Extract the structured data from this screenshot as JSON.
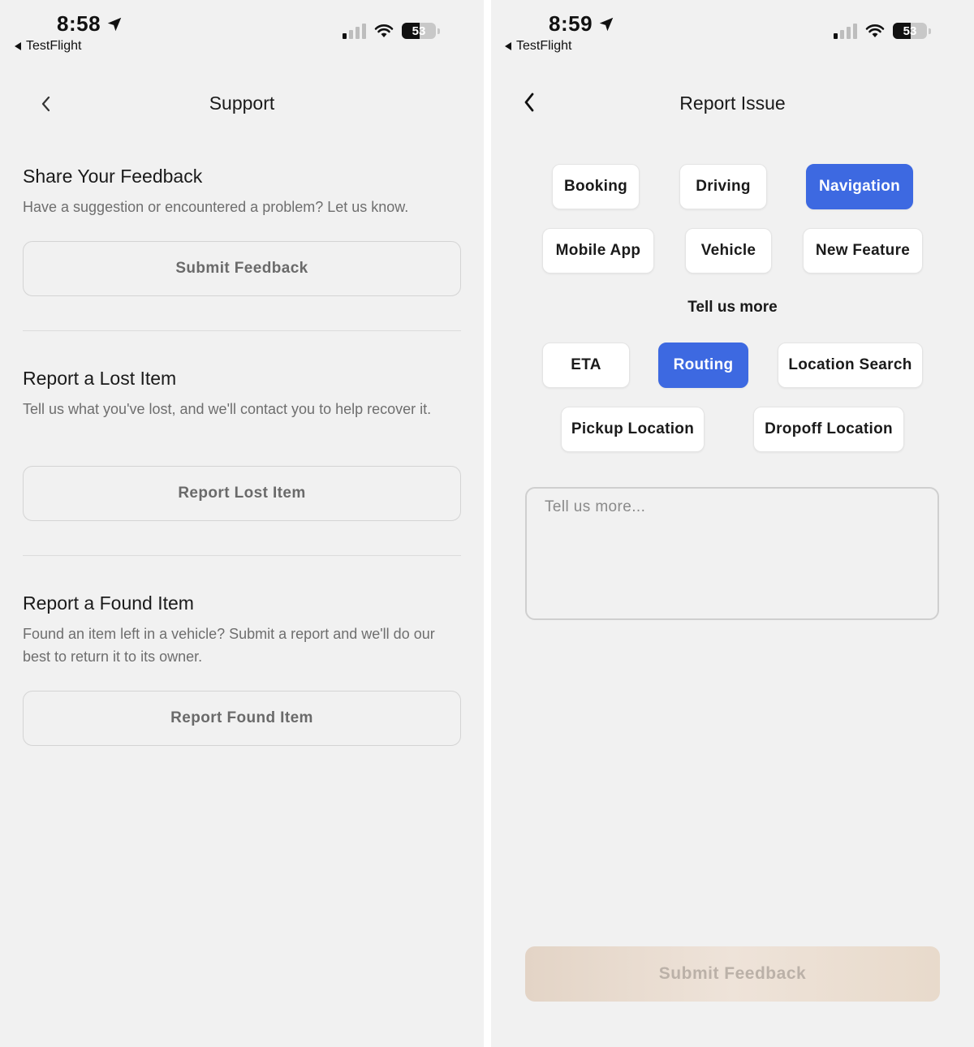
{
  "left": {
    "status": {
      "time": "8:58",
      "back_app": "TestFlight",
      "battery": "53"
    },
    "header": {
      "title": "Support"
    },
    "sections": [
      {
        "title": "Share Your Feedback",
        "description": "Have a suggestion or encountered a problem? Let us know.",
        "button": "Submit Feedback"
      },
      {
        "title": "Report a Lost Item",
        "description": "Tell us what you've lost, and we'll contact you to help recover it.",
        "button": "Report Lost Item"
      },
      {
        "title": "Report a Found Item",
        "description": "Found an item left in a vehicle? Submit a report and we'll do our best to return it to its owner.",
        "button": "Report Found Item"
      }
    ]
  },
  "right": {
    "status": {
      "time": "8:59",
      "back_app": "TestFlight",
      "battery": "53"
    },
    "header": {
      "title": "Report Issue"
    },
    "categories": [
      {
        "label": "Booking",
        "selected": false
      },
      {
        "label": "Driving",
        "selected": false
      },
      {
        "label": "Navigation",
        "selected": true
      },
      {
        "label": "Mobile App",
        "selected": false
      },
      {
        "label": "Vehicle",
        "selected": false
      },
      {
        "label": "New Feature",
        "selected": false
      }
    ],
    "tell_us_more_label": "Tell us more",
    "subcategories": [
      {
        "label": "ETA",
        "selected": false
      },
      {
        "label": "Routing",
        "selected": true
      },
      {
        "label": "Location Search",
        "selected": false
      },
      {
        "label": "Pickup Location",
        "selected": false
      },
      {
        "label": "Dropoff Location",
        "selected": false
      }
    ],
    "details_placeholder": "Tell us more...",
    "submit_label": "Submit Feedback"
  },
  "colors": {
    "background": "#f1f1f1",
    "accent_selected": "#3d69e1",
    "submit_disabled": "#e8dacb"
  },
  "icons": [
    "location-arrow-icon",
    "back-triangle-icon",
    "cellular-signal-icon",
    "wifi-icon",
    "battery-icon",
    "chevron-left-icon"
  ]
}
